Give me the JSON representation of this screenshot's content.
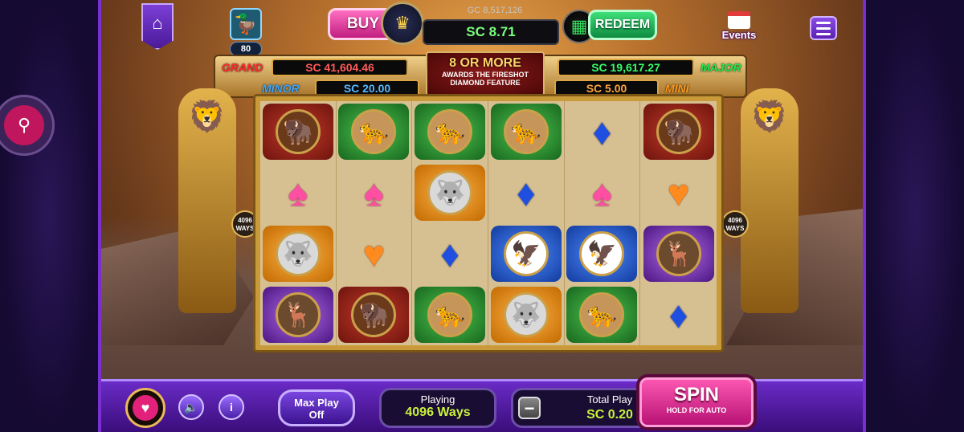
{
  "topbar": {
    "buy_label": "BUY",
    "gc_balance": "GC 8,517,126",
    "sc_balance": "SC 8.71",
    "redeem_label": "REDEEM",
    "events_label": "Events",
    "level": "80"
  },
  "jackpots": {
    "grand_label": "GRAND",
    "grand_value": "SC 41,604.46",
    "major_label": "MAJOR",
    "major_value": "SC 19,617.27",
    "minor_label": "MINOR",
    "minor_value": "SC 20.00",
    "mini_label": "MINI",
    "mini_value": "SC 5.00",
    "feature_big": "8 OR MORE",
    "feature_small": "AWARDS THE FIRESHOT DIAMOND FEATURE"
  },
  "ways_badge": {
    "line1": "4096",
    "line2": "WAYS"
  },
  "reels": [
    [
      "bison",
      "cougar",
      "cougar",
      "cougar",
      "diamond",
      "bison"
    ],
    [
      "spade",
      "spade",
      "wolf",
      "diamond",
      "spade",
      "heart"
    ],
    [
      "wolf",
      "heart",
      "diamond",
      "eagle",
      "eagle",
      "elk"
    ],
    [
      "elk",
      "bison",
      "cougar",
      "wolf",
      "cougar",
      "diamond"
    ]
  ],
  "bottom": {
    "maxplay_line1": "Max Play",
    "maxplay_line2": "Off",
    "playing_title": "Playing",
    "playing_value": "4096 Ways",
    "total_title": "Total Play",
    "total_value": "SC 0.20",
    "minus": "−",
    "plus": "+",
    "spin_label": "SPIN",
    "spin_sub": "HOLD FOR AUTO"
  },
  "icons": {
    "home": "home-icon",
    "profile": "duck-avatar-icon",
    "menu": "hamburger-menu-icon",
    "sound": "speaker-icon",
    "info": "info-icon",
    "favorite": "heart-icon",
    "search": "search-icon"
  },
  "colors": {
    "frame_purple": "#7a2fd0",
    "grand": "#ff2b2b",
    "major": "#1ee94a",
    "minor": "#3aa6ff",
    "mini": "#ff9a1a",
    "spin": "#ff5ab4"
  }
}
